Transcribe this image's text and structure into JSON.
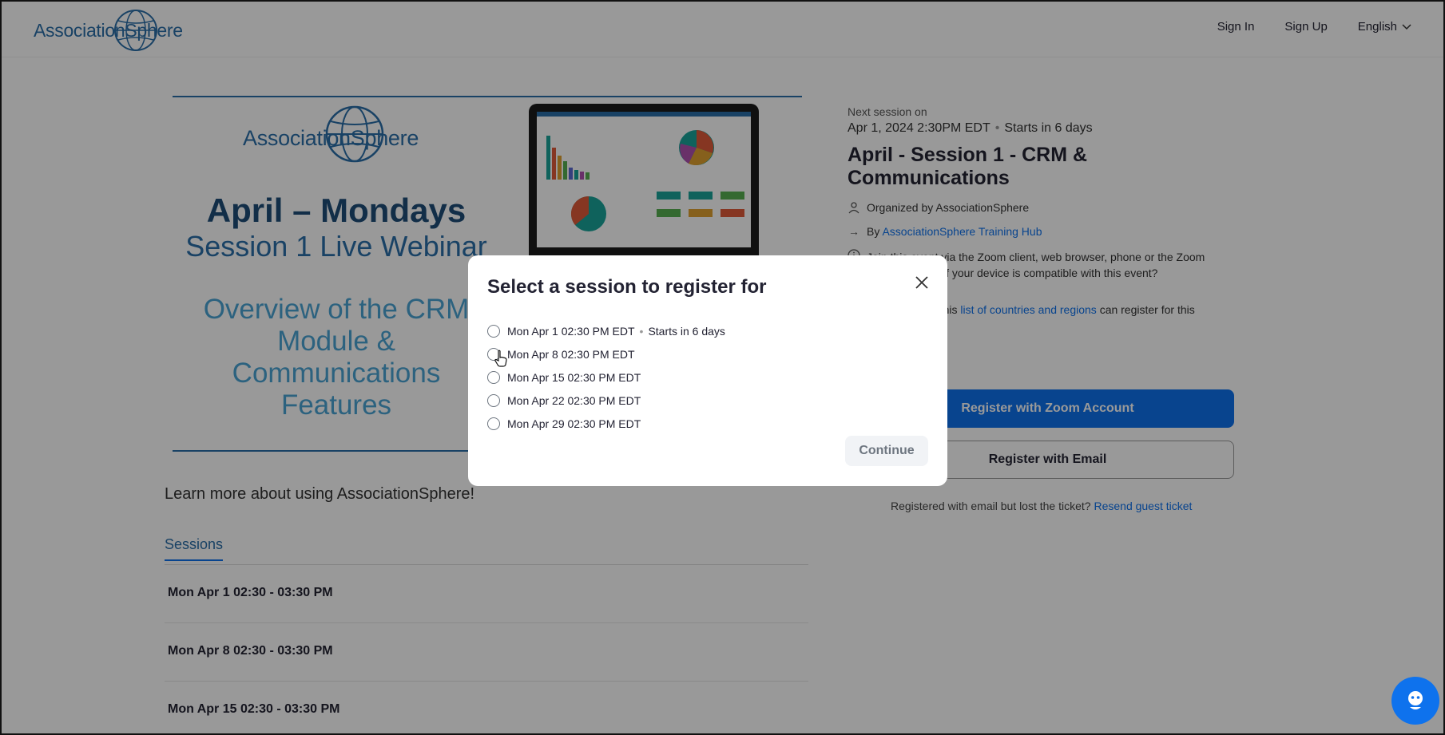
{
  "header": {
    "logo": "AssociationSphere",
    "nav": [
      "Sign In",
      "Sign Up",
      "English"
    ]
  },
  "banner": {
    "logo": "AssociationSphere",
    "title": "April – Mondays",
    "subtitle": "Session 1 Live Webinar",
    "desc_lines": [
      "Overview of the CRM",
      "Module &",
      "Communications",
      "Features"
    ]
  },
  "learn_more": "Learn more about using AssociationSphere!",
  "tabs": {
    "sessions": "Sessions"
  },
  "sessions": [
    "Mon Apr 1 02:30 - 03:30 PM",
    "Mon Apr 8 02:30 - 03:30 PM",
    "Mon Apr 15 02:30 - 03:30 PM"
  ],
  "event": {
    "next_label": "Next session on",
    "next_date": "Apr 1, 2024 2:30PM EDT",
    "starts_in": "Starts in 6 days",
    "title": "April - Session 1 - CRM & Communications",
    "organized": "Organized by AssociationSphere",
    "by_prefix": "By",
    "by_link": "AssociationSphere Training Hub",
    "join_text_1": "Join this event via the Zoom client, web browser, phone or the Zoom",
    "join_text_2": "if your device is compatible with this event?",
    "countries_prefix": "n this",
    "countries_link": "list of countries and regions",
    "countries_suffix": "can register for this",
    "register_zoom": "Register with Zoom Account",
    "register_email": "Register with Email",
    "lost_text": "Registered with email but lost the ticket?",
    "resend_link": "Resend guest ticket"
  },
  "modal": {
    "title": "Select a session to register for",
    "options": [
      {
        "label": "Mon Apr 1 02:30 PM EDT",
        "note": "Starts in 6 days"
      },
      {
        "label": "Mon Apr 8 02:30 PM EDT",
        "note": ""
      },
      {
        "label": "Mon Apr 15 02:30 PM EDT",
        "note": ""
      },
      {
        "label": "Mon Apr 22 02:30 PM EDT",
        "note": ""
      },
      {
        "label": "Mon Apr 29 02:30 PM EDT",
        "note": ""
      }
    ],
    "continue": "Continue"
  }
}
